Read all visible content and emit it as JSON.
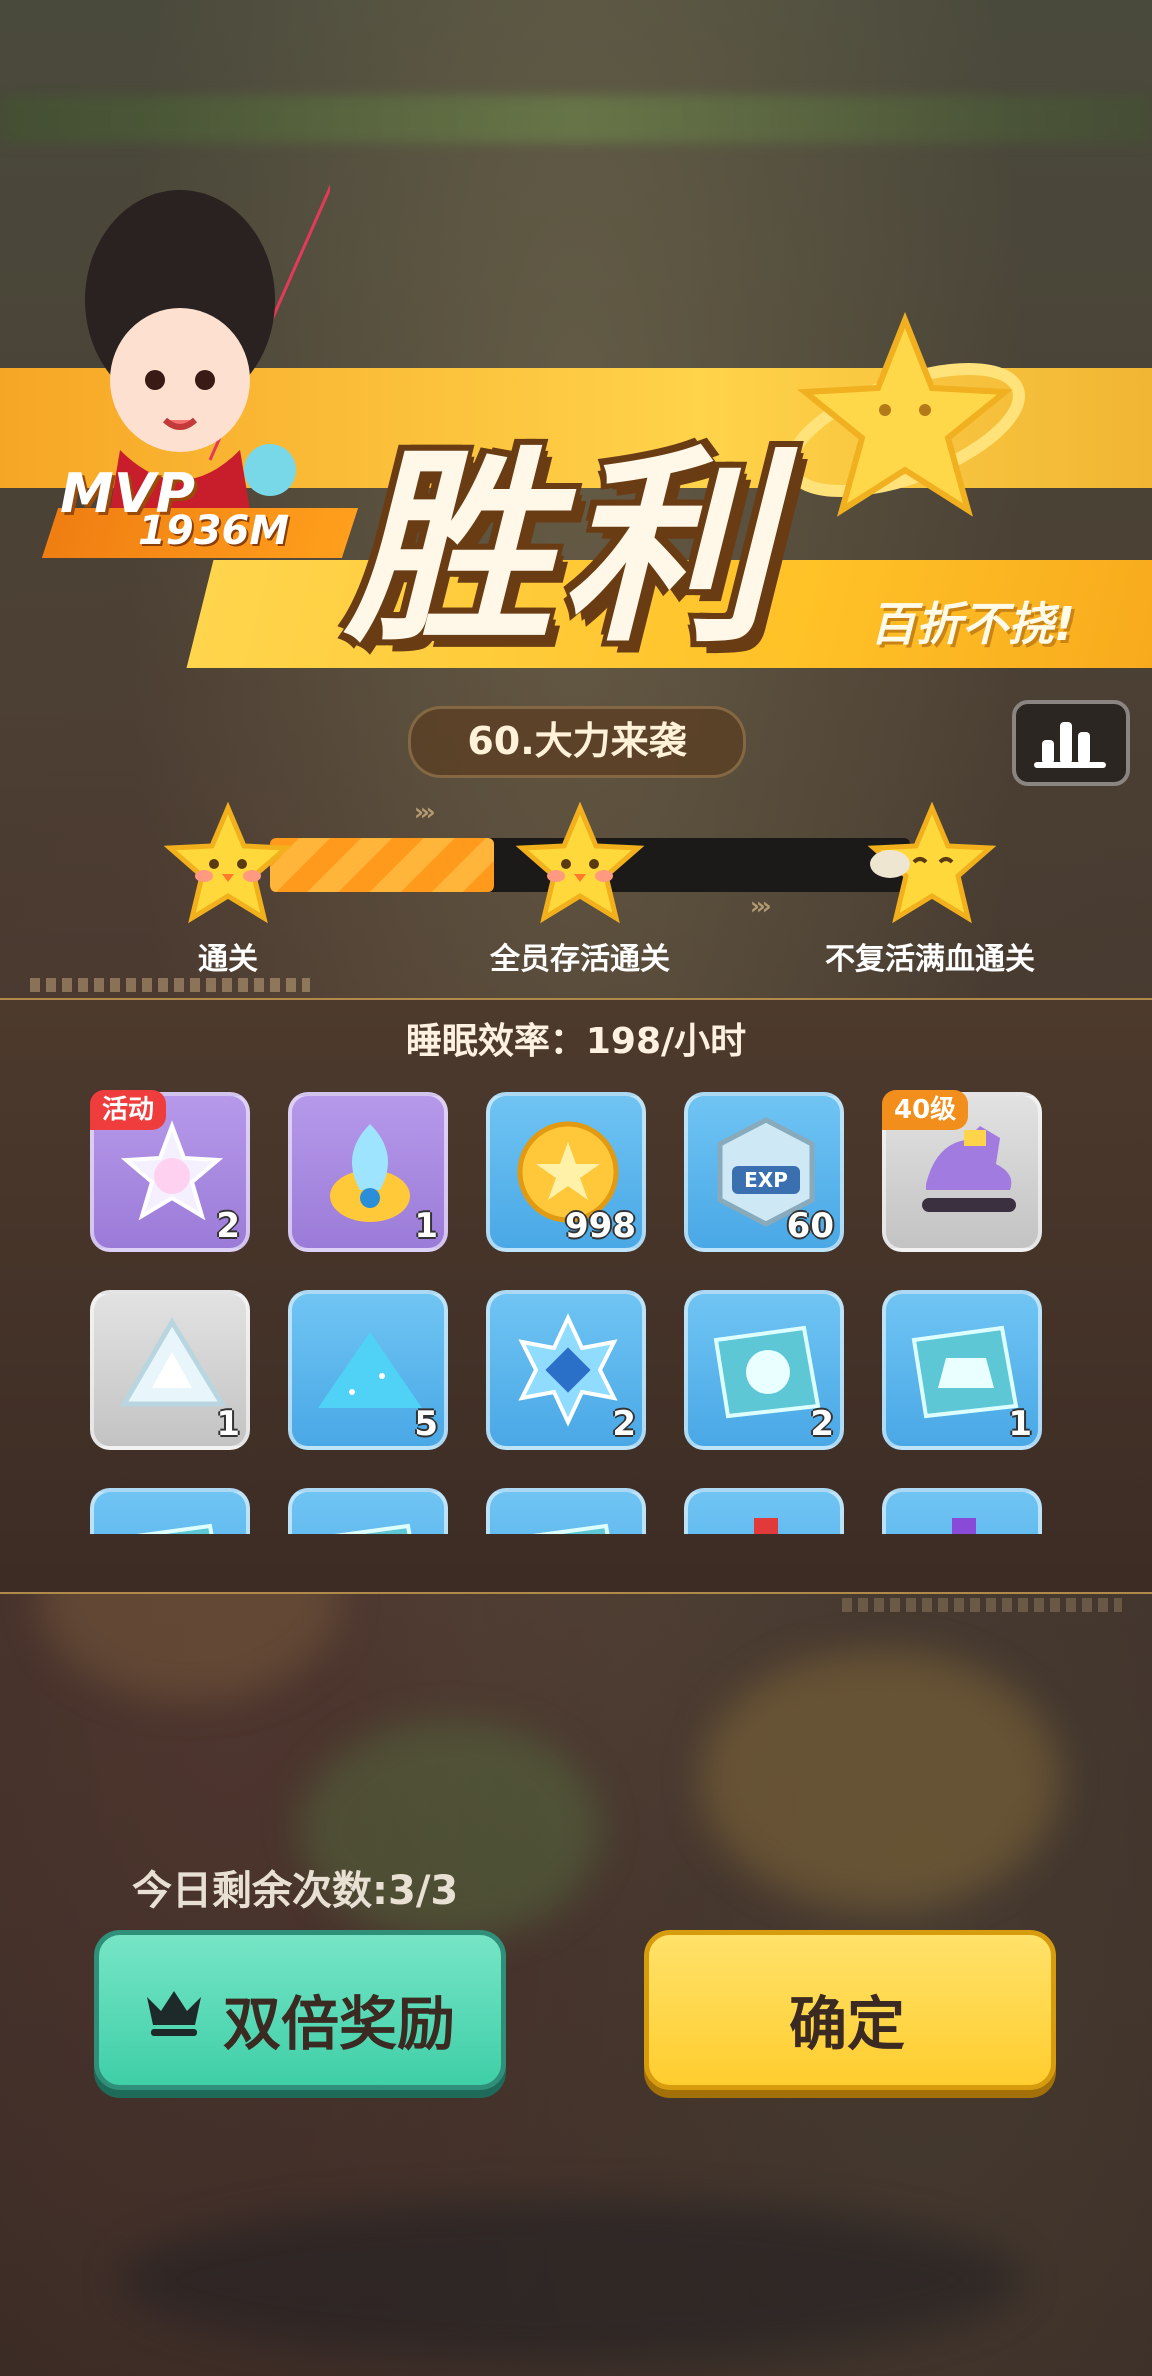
{
  "banner": {
    "title": "胜利",
    "slogan": "百折不挠!"
  },
  "mvp": {
    "label": "MVP",
    "score": "1936M"
  },
  "level": {
    "name": "60.大力来袭"
  },
  "progress": {
    "fill_fraction": 0.35,
    "stars": [
      {
        "label": "通关",
        "achieved": true
      },
      {
        "label": "全员存活通关",
        "achieved": true
      },
      {
        "label": "不复活满血通关",
        "achieved": false
      }
    ]
  },
  "rewards": {
    "sleep_efficiency": "睡眠效率：198/小时",
    "items": [
      {
        "icon": "rainbow-star-bottle-icon",
        "count": "2",
        "bg": "purple",
        "badge": "活动"
      },
      {
        "icon": "blue-flame-core-icon",
        "count": "1",
        "bg": "purple",
        "badge": ""
      },
      {
        "icon": "gold-coin-icon",
        "count": "998",
        "bg": "blue",
        "badge": ""
      },
      {
        "icon": "exp-badge-icon",
        "count": "60",
        "bg": "blue",
        "badge": ""
      },
      {
        "icon": "purple-shoe-icon",
        "count": "",
        "bg": "grey",
        "badge": "40级"
      },
      {
        "icon": "white-crystal-shard-icon",
        "count": "1",
        "bg": "grey",
        "badge": ""
      },
      {
        "icon": "blue-powder-pile-icon",
        "count": "5",
        "bg": "blue",
        "badge": ""
      },
      {
        "icon": "blue-rune-gem-icon",
        "count": "2",
        "bg": "blue",
        "badge": ""
      },
      {
        "icon": "helmet-blueprint-icon",
        "count": "2",
        "bg": "blue",
        "badge": ""
      },
      {
        "icon": "armor-blueprint-icon",
        "count": "1",
        "bg": "blue",
        "badge": ""
      },
      {
        "icon": "blueprint-icon",
        "count": "",
        "bg": "blue",
        "badge": ""
      },
      {
        "icon": "blueprint-icon",
        "count": "",
        "bg": "blue",
        "badge": ""
      },
      {
        "icon": "blueprint-icon",
        "count": "",
        "bg": "blue",
        "badge": ""
      },
      {
        "icon": "red-potion-icon",
        "count": "",
        "bg": "blue",
        "badge": ""
      },
      {
        "icon": "purple-potion-icon",
        "count": "",
        "bg": "blue",
        "badge": ""
      }
    ]
  },
  "footer": {
    "remaining": "今日剩余次数:3/3",
    "double_label": "双倍奖励",
    "confirm_label": "确定"
  },
  "colors": {
    "accent_yellow": "#ffcd2e",
    "accent_green": "#3fcfa7",
    "item_blue": "#4aa8e6",
    "item_purple": "#9b7bd8"
  }
}
